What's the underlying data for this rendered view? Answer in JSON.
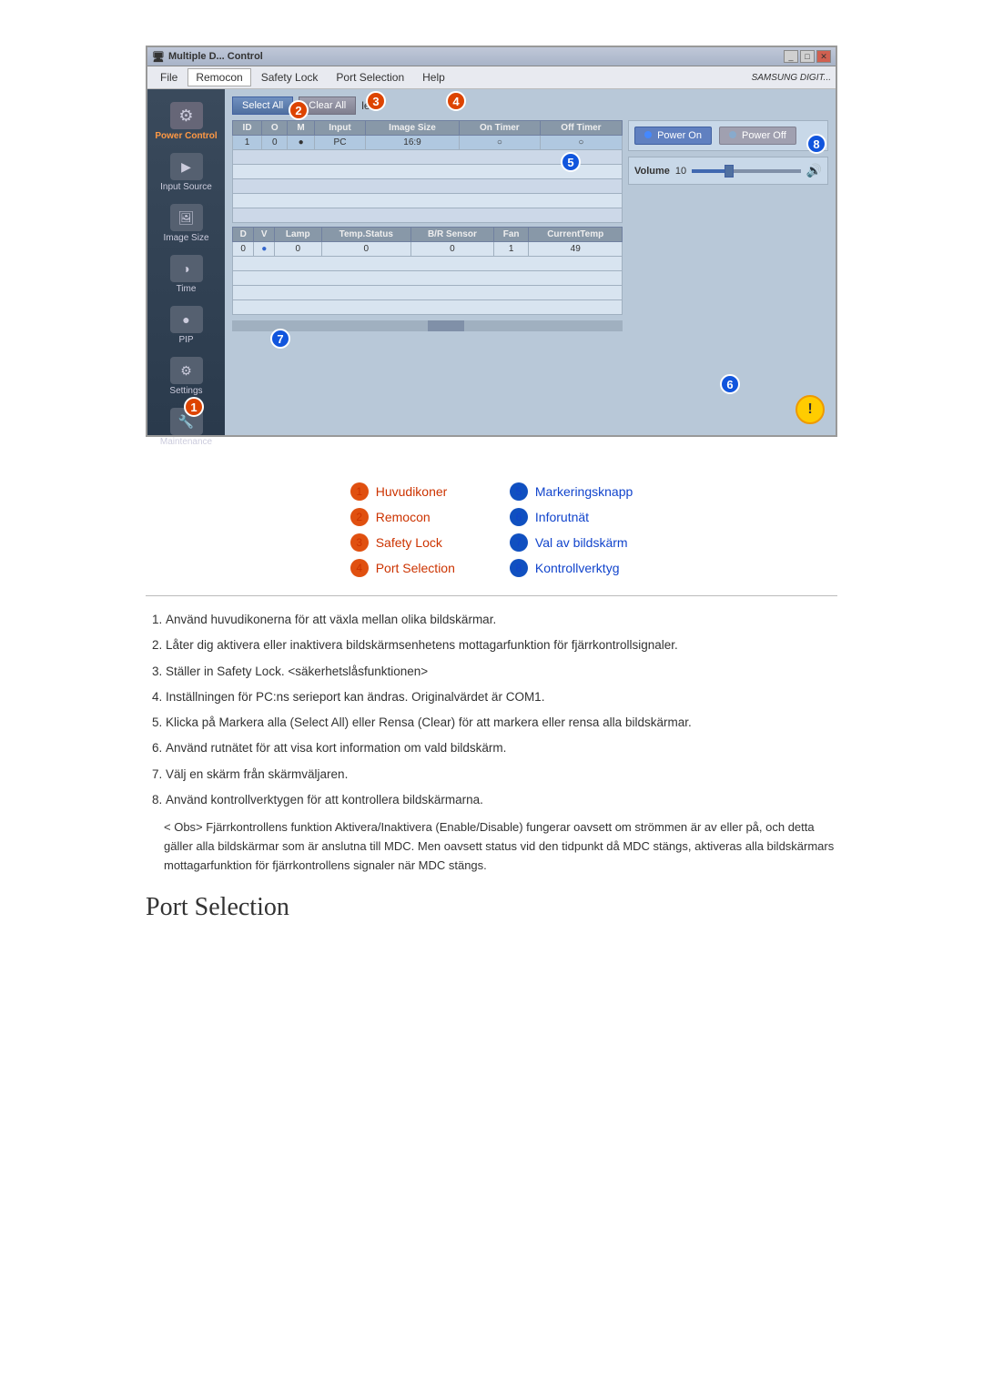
{
  "window": {
    "title": "Multiple Display Control",
    "title_short": "Multiple D... Control"
  },
  "menubar": {
    "items": [
      "File",
      "Remocon",
      "Safety Lock",
      "Port Selection",
      "Help"
    ],
    "logo": "SAMSUNG DIGIT..."
  },
  "toolbar": {
    "select_all": "Select All",
    "clear_all": "Clear All",
    "file_label": "le"
  },
  "top_table": {
    "headers": [
      "ID",
      "O",
      "M",
      "Input",
      "Image Size",
      "On Timer",
      "Off Timer"
    ],
    "rows": [
      [
        "1",
        "0",
        "●",
        "PC",
        "16:9",
        "○",
        "○"
      ]
    ]
  },
  "bottom_table": {
    "headers": [
      "D",
      "V",
      "Lamp",
      "Temp.Status",
      "B/R Sensor",
      "Fan",
      "CurrentTemp"
    ],
    "rows": [
      [
        "0",
        "●",
        "0",
        "0",
        "0",
        "1",
        "49"
      ]
    ]
  },
  "power_controls": {
    "power_on": "Power On",
    "power_off": "Power Off"
  },
  "volume": {
    "label": "Volume",
    "value": "10",
    "percent": 30
  },
  "sidebar": {
    "items": [
      {
        "label": "Power Control",
        "icon": "⚙"
      },
      {
        "label": "Input Source",
        "icon": "▶"
      },
      {
        "label": "Image Size",
        "icon": "🖼"
      },
      {
        "label": "Time",
        "icon": "◑"
      },
      {
        "label": "PIP",
        "icon": "●"
      },
      {
        "label": "Settings",
        "icon": "⚙"
      },
      {
        "label": "Maintenance",
        "icon": "🔧"
      }
    ]
  },
  "numbered_items": {
    "1": {
      "label": "Huvudikoner",
      "color": "orange"
    },
    "2": {
      "label": "Remocon",
      "color": "orange"
    },
    "3": {
      "label": "Safety Lock",
      "color": "orange"
    },
    "4": {
      "label": "Port Selection",
      "color": "orange"
    },
    "5": {
      "label": "Markeringsknapp",
      "color": "blue"
    },
    "6": {
      "label": "Inforutnät",
      "color": "blue"
    },
    "7": {
      "label": "Val av bildskärm",
      "color": "blue"
    },
    "8": {
      "label": "Kontrollverktyg",
      "color": "blue"
    }
  },
  "descriptions": [
    "Använd huvudikonerna för att växla mellan olika bildskärmar.",
    "Låter dig aktivera eller inaktivera bildskärmsenhetens mottagarfunktion för fjärrkontrollsignaler.",
    "Ställer in Safety Lock. <säkerhetslåsfunktionen>",
    "Inställningen för PC:ns serieport kan ändras. Originalvärdet är COM1.",
    "Klicka på Markera alla (Select All) eller Rensa (Clear) för att markera eller rensa alla bildskärmar.",
    "Använd rutnätet för att visa kort information om vald bildskärm.",
    "Välj en skärm från skärmväljaren.",
    "Använd kontrollverktygen för att kontrollera bildskärmarna."
  ],
  "obs_note": "< Obs>  Fjärrkontrollens funktion Aktivera/Inaktivera (Enable/Disable) fungerar oavsett om strömmen är av eller på, och detta gäller alla bildskärmar som är anslutna till MDC. Men oavsett status vid den tidpunkt då MDC stängs, aktiveras alla bildskärmars mottagarfunktion för fjärrkontrollens signaler när MDC stängs.",
  "page_heading": "Port Selection"
}
